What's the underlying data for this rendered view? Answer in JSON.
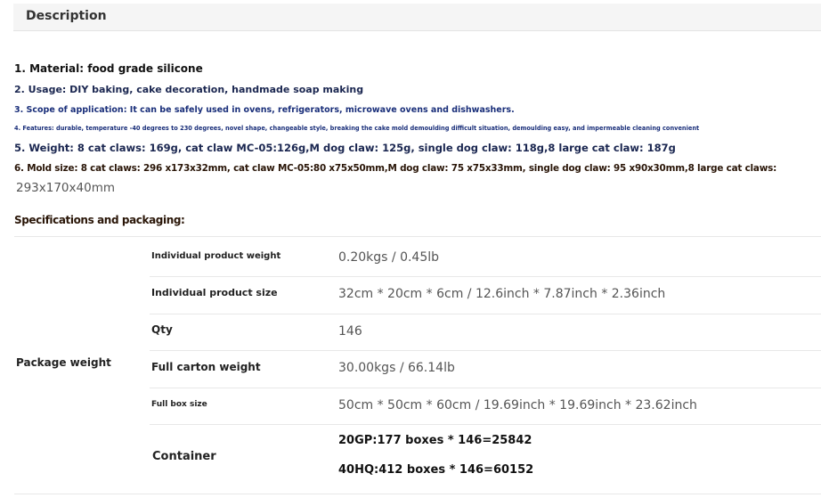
{
  "description": {
    "title": "Description"
  },
  "lines": [
    "1. Material: food grade silicone",
    "2. Usage: DIY baking, cake decoration, handmade soap making",
    "3. Scope of application: It can be safely used in ovens, refrigerators, microwave ovens and dishwashers.",
    "4. Features: durable, temperature -40 degrees to 230 degrees, novel shape, changeable style, breaking the cake mold demoulding difficult situation, demoulding easy, and impermeable cleaning convenient",
    "5. Weight: 8 cat claws: 169g, cat claw MC-05:126g,M dog claw: 125g, single dog claw: 118g,8 large cat claw: 187g",
    "6. Mold size: 8 cat claws: 296 x173x32mm, cat claw MC-05:80 x75x50mm,M dog claw: 75 x75x33mm, single dog claw: 95 x90x30mm,8 large cat claws:",
    "293x170x40mm"
  ],
  "specs": {
    "title": "Specifications and packaging:",
    "group_label": "Package weight",
    "rows": [
      {
        "label": "Individual product weight",
        "value": "0.20kgs / 0.45lb"
      },
      {
        "label": "Individual product size",
        "value": "32cm * 20cm * 6cm / 12.6inch * 7.87inch * 2.36inch"
      },
      {
        "label": "Qty",
        "value": "146"
      },
      {
        "label": "Full carton weight",
        "value": "30.00kgs / 66.14lb"
      },
      {
        "label": "Full box size",
        "value": "50cm * 50cm * 60cm / 19.69inch * 19.69inch * 23.62inch"
      }
    ],
    "container": {
      "label": "Container",
      "values": [
        "20GP:177 boxes * 146=25842",
        "40HQ:412 boxes * 146=60152"
      ]
    }
  }
}
